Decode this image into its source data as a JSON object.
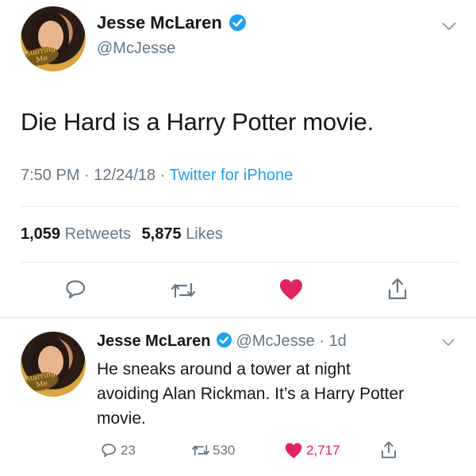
{
  "tweet": {
    "author_name": "Jesse McLaren",
    "author_handle": "@McJesse",
    "avatar_badge": "Starring Me",
    "text": "Die Hard is a Harry Potter movie.",
    "time": "7:50 PM",
    "date": "12/24/18",
    "separator": "·",
    "client": "Twitter for iPhone",
    "retweets_count": "1,059",
    "retweets_label": "Retweets",
    "likes_count": "5,875",
    "likes_label": "Likes"
  },
  "reply": {
    "author_name": "Jesse McLaren",
    "author_handle": "@McJesse",
    "separator": "·",
    "age": "1d",
    "avatar_badge": "Starring Me",
    "text_line1": "He sneaks around a tower at night",
    "text_line2": "avoiding Alan Rickman. It’s a Harry Potter",
    "text_line3": "movie.",
    "reply_count": "23",
    "retweet_count": "530",
    "like_count": "2,717"
  },
  "colors": {
    "accent": "#1da1f2",
    "like": "#e0245e",
    "muted": "#657786",
    "divider": "#e6ecf0"
  },
  "icons": {
    "verified": "verified-badge-icon",
    "caret": "chevron-down-icon",
    "reply": "comment-bubble-icon",
    "retweet": "retweet-arrows-icon",
    "like": "heart-icon",
    "share": "share-upload-icon"
  }
}
